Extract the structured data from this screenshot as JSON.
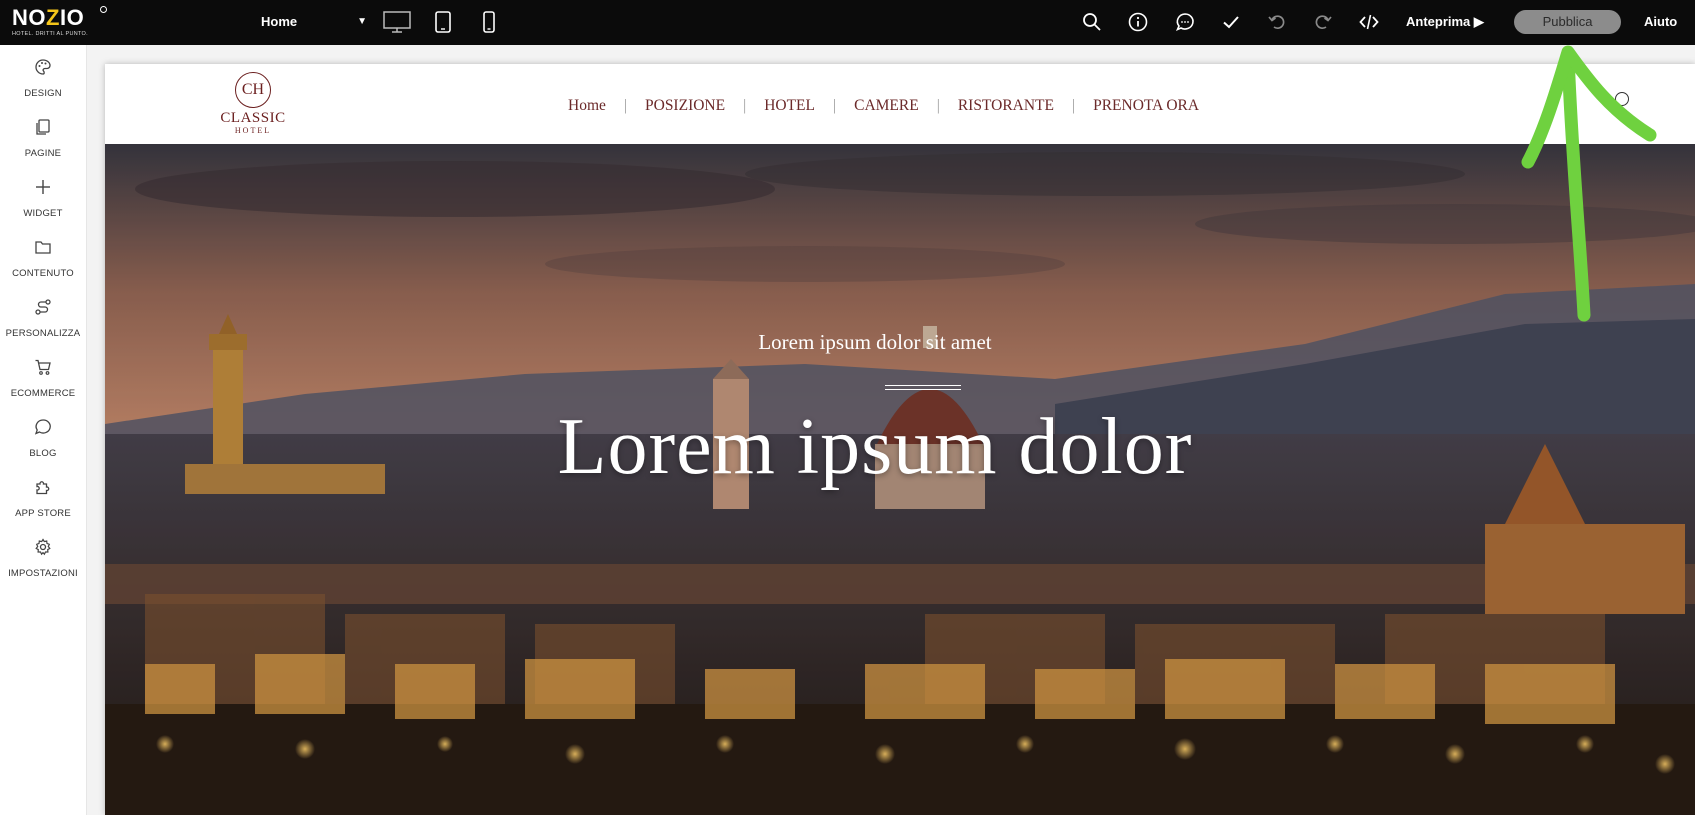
{
  "topbar": {
    "logo": {
      "word_start": "NO",
      "word_accent": "Z",
      "word_end": "IO",
      "tagline": "HOTEL. DRITTI AL PUNTO."
    },
    "page_selector": {
      "value": "Home"
    },
    "devices": [
      "desktop-icon",
      "tablet-icon",
      "mobile-icon"
    ],
    "tools": [
      "search-icon",
      "info-icon",
      "comment-icon",
      "check-icon",
      "undo-icon",
      "redo-icon",
      "code-icon"
    ],
    "preview_label": "Anteprima ▶",
    "publish_label": "Pubblica",
    "help_label": "Aiuto",
    "background": "#0b0b0b",
    "accent": "#f4c51a"
  },
  "sidebar": {
    "items": [
      {
        "label": "DESIGN",
        "icon": "palette-icon"
      },
      {
        "label": "PAGINE",
        "icon": "pages-icon"
      },
      {
        "label": "WIDGET",
        "icon": "plus-icon"
      },
      {
        "label": "CONTENUTO",
        "icon": "folder-icon"
      },
      {
        "label": "PERSONALIZZA",
        "icon": "route-icon"
      },
      {
        "label": "ECOMMERCE",
        "icon": "cart-icon"
      },
      {
        "label": "BLOG",
        "icon": "chat-bubble-icon"
      },
      {
        "label": "APP STORE",
        "icon": "puzzle-icon"
      },
      {
        "label": "IMPOSTAZIONI",
        "icon": "gear-icon"
      }
    ]
  },
  "site": {
    "logo": {
      "monogram": "CH",
      "name": "CLASSIC",
      "sub": "HOTEL"
    },
    "nav": [
      "Home",
      "POSIZIONE",
      "HOTEL",
      "CAMERE",
      "RISTORANTE",
      "PRENOTA ORA"
    ],
    "nav_separator": "|",
    "hero": {
      "subtitle": "Lorem ipsum dolor sit amet",
      "title": "Lorem ipsum dolor"
    },
    "brand_color": "#6b2a2a"
  },
  "annotation": {
    "color": "#6fd13f",
    "shape": "arrow-up-pointing-at-publish"
  }
}
